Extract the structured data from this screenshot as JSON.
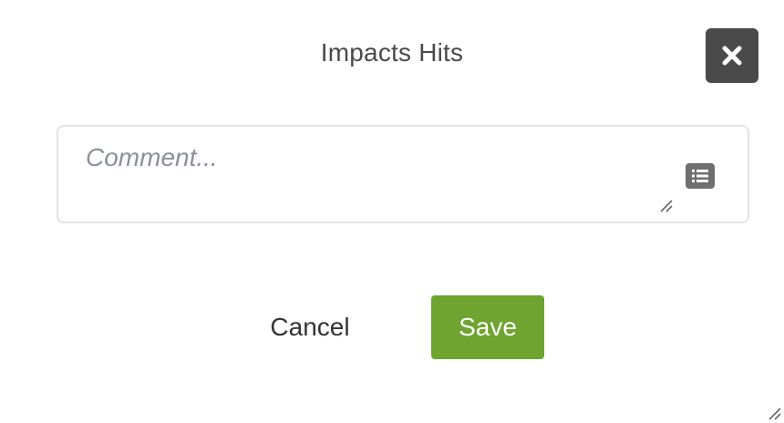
{
  "dialog": {
    "title": "Impacts Hits",
    "close_icon": "close-icon",
    "comment": {
      "placeholder": "Comment...",
      "value": "",
      "list_icon": "list-icon"
    },
    "buttons": {
      "cancel_label": "Cancel",
      "save_label": "Save"
    }
  },
  "colors": {
    "close_button_bg": "#4a4a4a",
    "save_button_bg": "#6ea42f",
    "border": "#e3e3e3",
    "placeholder": "#8a8f98"
  }
}
